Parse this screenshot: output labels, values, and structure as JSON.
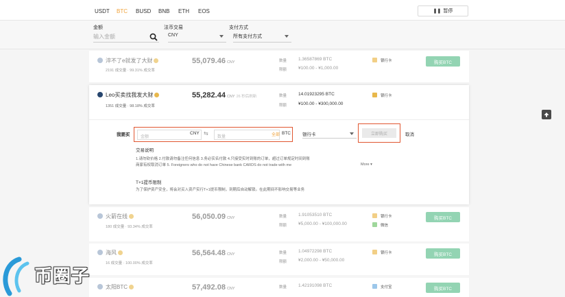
{
  "tabs": [
    "USDT",
    "BTC",
    "BUSD",
    "BNB",
    "ETH",
    "EOS"
  ],
  "active_tab": "BTC",
  "pause_label": "暂停",
  "filters": {
    "amount_label": "金额",
    "amount_placeholder": "输入金额",
    "fiat_label": "法币交易",
    "fiat_value": "CNY",
    "payment_label": "支付方式",
    "payment_value": "所有支付方式"
  },
  "labels": {
    "qty": "数量",
    "limit": "限额"
  },
  "buy_label": "购买BTC",
  "rows": [
    {
      "name": "淬不了e就发了大财",
      "stats": "2191 成交量 · 99.31% 成交率",
      "price": "55,079.46",
      "unit": "CNY",
      "qty": "1.36587869 BTC",
      "limit": "¥100.00 - ¥1,000.00",
      "pay": [
        "银行卡"
      ]
    },
    {
      "name": "Leo买卖找我发大财",
      "stats": "1351 成交量 · 98.18% 成交率",
      "price": "55,282.44",
      "unit": "CNY",
      "price_note": "26 秒后刷新",
      "qty": "14.01923295 BTC",
      "limit": "¥100.00 - ¥300,000.00",
      "pay": [
        "银行卡"
      ]
    },
    {
      "name": "火箭在线",
      "stats": "180 成交量 · 93.34% 成交率",
      "price": "56,050.09",
      "unit": "CNY",
      "qty": "1.91053510 BTC",
      "limit": "¥5,000.00 - ¥100,000.00",
      "pay": [
        "银行卡",
        "微信"
      ]
    },
    {
      "name": "海风",
      "stats": "16 成交量 · 100.00% 成交率",
      "price": "56,564.48",
      "unit": "CNY",
      "qty": "1.04972298 BTC",
      "limit": "¥2,000.00 - ¥50,000.00",
      "pay": [
        "银行卡"
      ]
    },
    {
      "name": "太阳BTC",
      "stats": "",
      "price": "57,492.08",
      "unit": "CNY",
      "qty": "1.42191098 BTC",
      "limit": "",
      "pay": [
        "支付宝"
      ]
    }
  ],
  "order_form": {
    "i_want_buy": "我要买",
    "amount_placeholder": "金额",
    "amount_unit": "CNY",
    "qty_placeholder": "数量",
    "all_label": "全部",
    "qty_unit": "BTC",
    "payment_select": "银行卡",
    "confirm_label": "立即购买",
    "cancel_label": "取消"
  },
  "notes": {
    "title": "交易说明",
    "line1": "1.请勿砍价格 2.付款请勿备注任何信息 3.务必实名付款 4.只接受实时到账的订单，超过订单规定时间到账",
    "line2": "商家有权取消订单 5. Foreigners who do not have Chinese bank CARDS do not trade with me",
    "more": "More",
    "t1_title": "T+1提币限制",
    "t1_text": "为了保护资产安全，将会对买入资产实行T+1提币限制，到期后自动解锁。在此期间不影响交易等业务"
  },
  "watermark_text": "币圈子",
  "colors": {
    "accent": "#f0a23a",
    "buy_green": "#93d4b3",
    "highlight_red": "#e0552f"
  }
}
